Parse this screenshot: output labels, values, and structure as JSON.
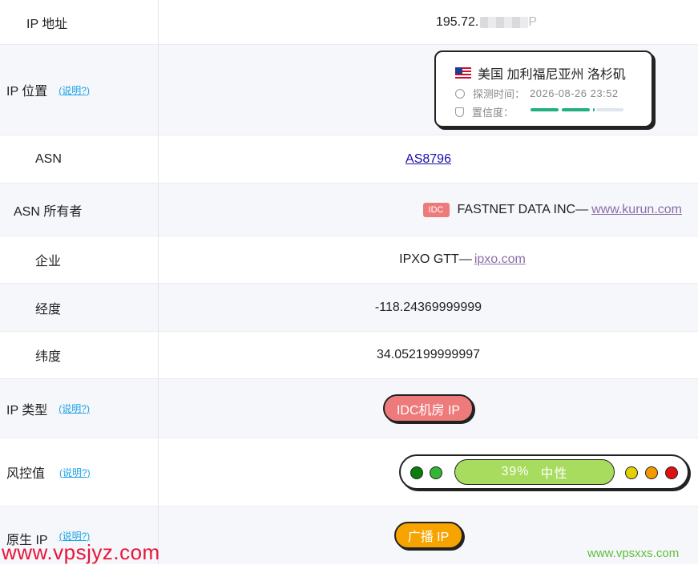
{
  "rows": {
    "ip": {
      "label": "IP 地址",
      "value_prefix": "195.72.",
      "value_suffix": "P"
    },
    "location": {
      "label": "IP 位置",
      "help": "(说明?)",
      "country_city": "美国 加利福尼亚州 洛杉矶",
      "detect_time_label": "探测时间：",
      "detect_time": "2026-08-26 23:52",
      "confidence_label": "置信度："
    },
    "asn": {
      "label": "ASN",
      "value": "AS8796"
    },
    "asn_owner": {
      "label": "ASN 所有者",
      "tag": "IDC",
      "name": "FASTNET DATA INC—",
      "link": "www.kurun.com"
    },
    "company": {
      "label": "企业",
      "name": "IPXO GTT—",
      "link": "ipxo.com"
    },
    "longitude": {
      "label": "经度",
      "value": "-118.24369999999"
    },
    "latitude": {
      "label": "纬度",
      "value": "34.052199999997"
    },
    "ip_type": {
      "label": "IP 类型",
      "help": "(说明?)",
      "value": "IDC机房 IP"
    },
    "risk": {
      "label": "风控值",
      "help": "(说明?)",
      "percent": "39%",
      "level": "中性"
    },
    "native_ip": {
      "label": "原生 IP",
      "help": "(说明?)",
      "value": "广播 IP"
    }
  },
  "colors": {
    "risk_dots_left": [
      "#0a7d0a",
      "#34b534"
    ],
    "risk_dots_right": [
      "#e2d000",
      "#f29a00",
      "#e01010"
    ],
    "accent_link": "#1aa3e8"
  },
  "watermarks": {
    "left": "www.vpsjyz.com",
    "right": "www.vpsxxs.com"
  }
}
